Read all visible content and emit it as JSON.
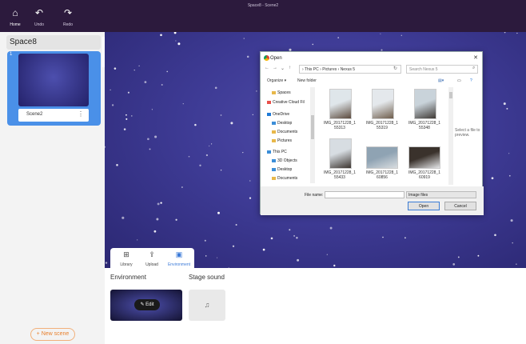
{
  "window": {
    "title": "Space8 - Scene2"
  },
  "toolbar": {
    "home": {
      "label": "Home",
      "icon": "home-icon"
    },
    "undo": {
      "label": "Undo",
      "icon": "undo-icon"
    },
    "redo": {
      "label": "Redo",
      "icon": "redo-icon"
    }
  },
  "sidebar": {
    "space_name": "Space8",
    "scenes": [
      {
        "number": "1",
        "name": "Scene2"
      }
    ],
    "new_scene_label": "+ New scene"
  },
  "tools": [
    {
      "icon": "cube-icon"
    },
    {
      "icon": "list-icon"
    }
  ],
  "bottom_tabs": [
    {
      "label": "Library",
      "icon": "library-icon"
    },
    {
      "label": "Upload",
      "icon": "upload-icon"
    },
    {
      "label": "Environment",
      "icon": "image-icon",
      "active": true
    }
  ],
  "environment": {
    "label": "Environment",
    "edit_label": "✎ Edit"
  },
  "stage_sound": {
    "label": "Stage sound",
    "icon": "music-icon"
  },
  "dialog": {
    "title": "Open",
    "address": "› This PC › Pictures › Nexus 5",
    "search_placeholder": "Search Nexus 5",
    "organize": "Organize ▾",
    "new_folder": "New folder",
    "nav_items": [
      {
        "label": "Spaces",
        "kind": "folder"
      },
      {
        "label": "Creative Cloud Fil",
        "kind": "cc"
      },
      {
        "label": "OneDrive",
        "kind": "cloud"
      },
      {
        "label": "Desktop",
        "kind": "folder-blue"
      },
      {
        "label": "Documents",
        "kind": "folder"
      },
      {
        "label": "Pictures",
        "kind": "folder"
      },
      {
        "label": "This PC",
        "kind": "pc"
      },
      {
        "label": "3D Objects",
        "kind": "folder-blue"
      },
      {
        "label": "Desktop",
        "kind": "folder-blue"
      },
      {
        "label": "Documents",
        "kind": "folder"
      }
    ],
    "files": [
      {
        "line1": "IMG_20171228_1",
        "line2": "55313",
        "shape": "tall",
        "colors": [
          "#dfe6ea",
          "#5b4a3d"
        ]
      },
      {
        "line1": "IMG_20171228_1",
        "line2": "55319",
        "shape": "tall",
        "colors": [
          "#e4e8ec",
          "#6e5d4c"
        ]
      },
      {
        "line1": "IMG_20171228_1",
        "line2": "55348",
        "shape": "tall",
        "colors": [
          "#c9d3da",
          "#3f3a36"
        ]
      },
      {
        "line1": "IMG_20171228_1",
        "line2": "55433",
        "shape": "tall",
        "colors": [
          "#d7dde2",
          "#3b342f"
        ]
      },
      {
        "line1": "IMG_20171228_1",
        "line2": "60856",
        "shape": "wide",
        "colors": [
          "#8fa3b3",
          "#d9dde0"
        ]
      },
      {
        "line1": "IMG_20171228_1",
        "line2": "60919",
        "shape": "wide",
        "colors": [
          "#3a322c",
          "#e4e6e8"
        ]
      }
    ],
    "preview_text": "Select a file to preview.",
    "file_name_label": "File name:",
    "file_type": "Image files",
    "open_label": "Open",
    "cancel_label": "Cancel"
  }
}
